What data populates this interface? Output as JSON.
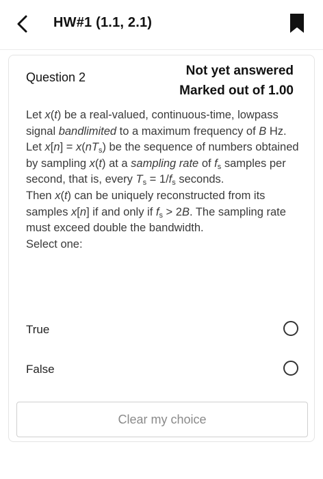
{
  "header": {
    "title": "HW#1 (1.1, 2.1)",
    "back_icon": "chevron-left-icon",
    "bookmark_icon": "bookmark-icon"
  },
  "question": {
    "number_label": "Question 2",
    "status_line1": "Not yet answered",
    "status_line2": "Marked out of 1.00",
    "text": {
      "p1_a": "Let ",
      "p1_x": "x",
      "p1_b": "(",
      "p1_t": "t",
      "p1_c": ") be a real-valued, continuous-time, lowpass signal ",
      "p1_band": "bandlimited",
      "p1_d": " to a maximum frequency of ",
      "p1_B": "B",
      "p1_e": " Hz.",
      "p2_a": "Let ",
      "p2_x1": "x",
      "p2_b": "[",
      "p2_n1": "n",
      "p2_c": "] = ",
      "p2_x2": "x",
      "p2_d": "(",
      "p2_n2": "nT",
      "p2_sub1": "s",
      "p2_e": ") be the sequence of numbers obtained by sampling ",
      "p2_x3": "x",
      "p2_f": "(",
      "p2_t": "t",
      "p2_g": ") at a ",
      "p2_rate": "sampling rate",
      "p2_h": " of ",
      "p2_fs": "f",
      "p2_sub2": "s",
      "p2_i": " samples per second, that is, every ",
      "p2_Ts": "T",
      "p2_sub3": "s",
      "p2_j": " = 1/",
      "p2_fs2": "f",
      "p2_sub4": "s",
      "p2_k": " seconds.",
      "p3_a": "Then ",
      "p3_x1": "x",
      "p3_b": "(",
      "p3_t": "t",
      "p3_c": ") can be uniquely reconstructed from its samples ",
      "p3_x2": "x",
      "p3_d": "[",
      "p3_n": "n",
      "p3_e": "] if and only if ",
      "p3_fs": "f",
      "p3_sub": "s",
      "p3_f": "  > 2",
      "p3_B": "B",
      "p3_g": ". The sampling rate must exceed double the bandwidth.",
      "select_one": "Select one:"
    },
    "options": [
      {
        "label": "True",
        "selected": false
      },
      {
        "label": "False",
        "selected": false
      }
    ],
    "clear_label": "Clear my choice"
  },
  "colors": {
    "text": "#3a3a3a",
    "title": "#111111",
    "border": "#e4e4e4",
    "clear_text": "#8a8a8a"
  }
}
